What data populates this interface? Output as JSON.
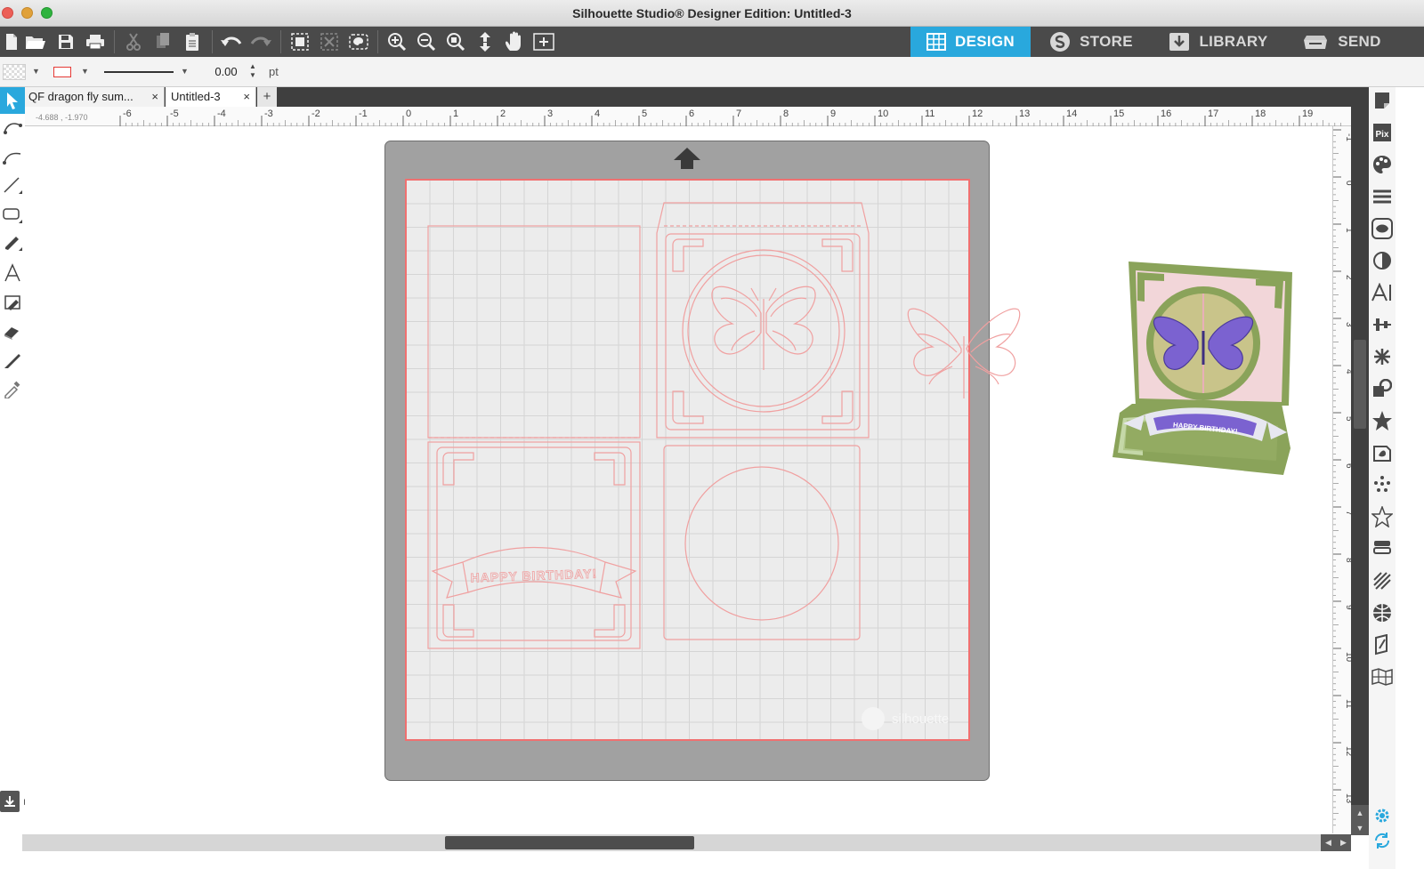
{
  "window": {
    "title": "Silhouette Studio® Designer Edition: Untitled-3"
  },
  "nav_tabs": [
    {
      "label": "DESIGN",
      "icon": "grid-icon",
      "active": true
    },
    {
      "label": "STORE",
      "icon": "silhouette-s-icon",
      "active": false
    },
    {
      "label": "LIBRARY",
      "icon": "library-download-icon",
      "active": false
    },
    {
      "label": "SEND",
      "icon": "cutter-icon",
      "active": false
    }
  ],
  "options_bar": {
    "line_weight": "0.00",
    "unit": "pt"
  },
  "doc_tabs": [
    {
      "label": "QF dragon fly sum...",
      "close": "×"
    },
    {
      "label": "Untitled-3",
      "close": "×"
    }
  ],
  "doc_add": "+",
  "ruler": {
    "coords": "-4.688 , -1.970",
    "h_labels": [
      "-6",
      "-5",
      "-4",
      "-3",
      "-2",
      "-1",
      "0",
      "1",
      "2",
      "3",
      "4",
      "5",
      "6",
      "7",
      "8",
      "9",
      "10",
      "11",
      "12",
      "13",
      "14",
      "15",
      "16",
      "17",
      "18",
      "19"
    ],
    "v_labels": [
      "-1",
      "0",
      "1",
      "2",
      "3",
      "4",
      "5",
      "6",
      "7",
      "8",
      "9",
      "10",
      "11",
      "12",
      "13"
    ]
  },
  "design": {
    "banner_text": "HAPPY BIRTHDAY!",
    "watermark": "silhouette"
  },
  "preview": {
    "banner_text": "HAPPY BIRTHDAY!"
  },
  "colors": {
    "accent": "#29a8dd",
    "cut_line": "#f07070",
    "toolbar": "#4a4a4a",
    "mat": "#a1a1a1",
    "card_green": "#8aa35a",
    "card_pink": "#f2d6d9",
    "butterfly_purple": "#7b62d0"
  }
}
